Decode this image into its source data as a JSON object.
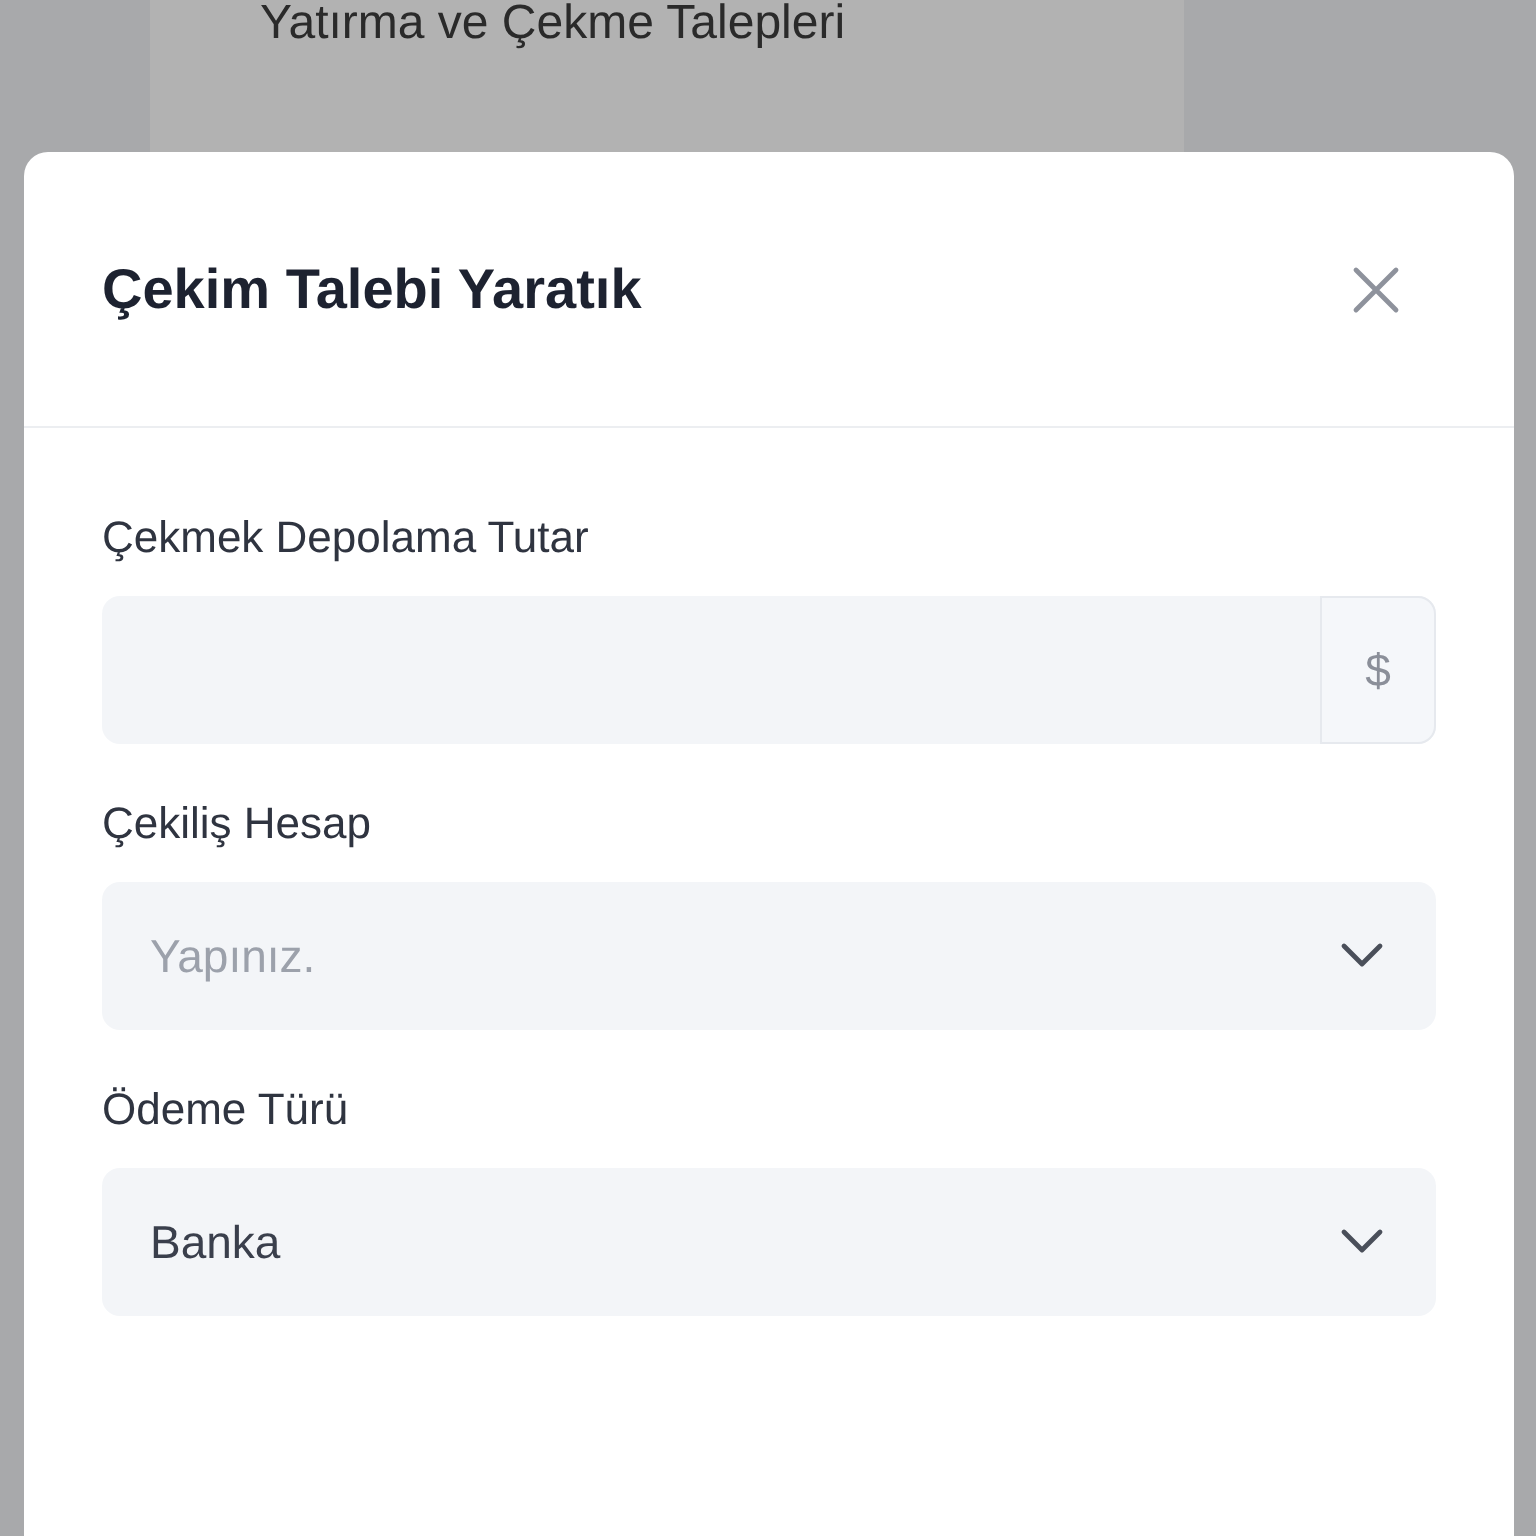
{
  "background": {
    "heading": "Yatırma ve Çekme Talepleri"
  },
  "modal": {
    "title": "Çekim Talebi Yaratık",
    "fields": [
      {
        "kind": "amount",
        "label": "Çekmek Depolama Tutar",
        "addon": "$"
      },
      {
        "kind": "select",
        "label": "Çekiliş Hesap",
        "placeholder": "Yapınız."
      },
      {
        "kind": "select",
        "label": "Ödeme Türü",
        "value": "Banka"
      }
    ]
  }
}
